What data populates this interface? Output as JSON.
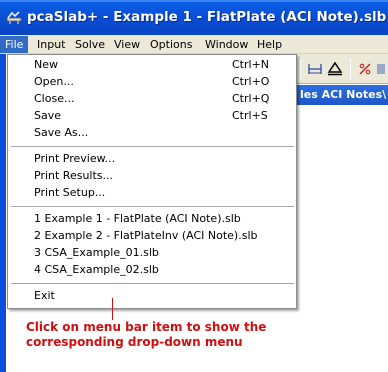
{
  "window": {
    "title": "pcaSlab+ - Example 1 - FlatPlate (ACI Note).slb",
    "app_icon": "pcaslab-app-icon",
    "colors": {
      "titlebar": "#0b4fd8",
      "highlight": "#316ac5",
      "callout": "#d01010"
    }
  },
  "menubar": {
    "items": [
      {
        "label": "File",
        "active": true
      },
      {
        "label": "Input"
      },
      {
        "label": "Solve"
      },
      {
        "label": "View"
      },
      {
        "label": "Options"
      },
      {
        "label": "Window"
      },
      {
        "label": "Help"
      }
    ]
  },
  "file_menu": {
    "new": {
      "label": "New",
      "shortcut": "Ctrl+N"
    },
    "open": {
      "label": "Open...",
      "shortcut": "Ctrl+O"
    },
    "close": {
      "label": "Close...",
      "shortcut": "Ctrl+Q"
    },
    "save": {
      "label": "Save",
      "shortcut": "Ctrl+S"
    },
    "save_as": {
      "label": "Save As..."
    },
    "print_preview": {
      "label": "Print Preview..."
    },
    "print_results": {
      "label": "Print Results..."
    },
    "print_setup": {
      "label": "Print Setup..."
    },
    "recent": [
      "1 Example 1 - FlatPlate (ACI Note).slb",
      "2 Example 2 - FlatPlateInv (ACI Note).slb",
      "3 CSA_Example_01.slb",
      "4 CSA_Example_02.slb"
    ],
    "exit": {
      "label": "Exit"
    }
  },
  "document": {
    "title_partial": "les ACI Notes\\"
  },
  "annotation": {
    "text_line1": "Click on menu bar item to show the",
    "text_line2": "corresponding drop-down menu"
  }
}
